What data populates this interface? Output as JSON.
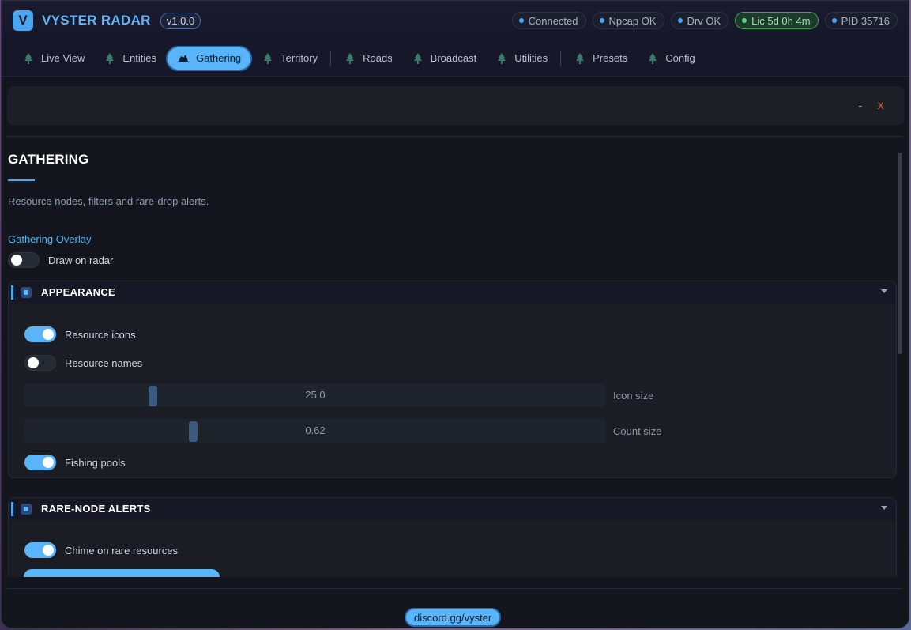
{
  "app": {
    "logo_letter": "V",
    "title": "VYSTER RADAR",
    "version": "v1.0.0"
  },
  "status": [
    {
      "label": "Connected",
      "state": "info"
    },
    {
      "label": "Npcap OK",
      "state": "info"
    },
    {
      "label": "Drv OK",
      "state": "info"
    },
    {
      "label": "Lic 5d 0h 4m",
      "state": "ok"
    },
    {
      "label": "PID 35716",
      "state": "info"
    }
  ],
  "tabs": [
    {
      "label": "Live View",
      "icon": "tree-icon"
    },
    {
      "label": "Entities",
      "icon": "tree-icon"
    },
    {
      "label": "Gathering",
      "icon": "ore-icon",
      "active": true
    },
    {
      "label": "Territory",
      "icon": "tree-icon"
    },
    {
      "label": "Roads",
      "icon": "tree-icon"
    },
    {
      "label": "Broadcast",
      "icon": "tree-icon"
    },
    {
      "label": "Utilities",
      "icon": "tree-icon"
    },
    {
      "label": "Presets",
      "icon": "tree-icon"
    },
    {
      "label": "Config",
      "icon": "tree-icon"
    }
  ],
  "window_controls": {
    "minimize": "-",
    "close": "X"
  },
  "page": {
    "heading": "GATHERING",
    "subtitle": "Resource nodes, filters and rare-drop alerts.",
    "section_label": "Gathering Overlay",
    "draw_on_radar": {
      "label": "Draw on radar",
      "on": false
    }
  },
  "appearance": {
    "title": "APPEARANCE",
    "resource_icons": {
      "label": "Resource icons",
      "on": true
    },
    "resource_names": {
      "label": "Resource names",
      "on": false
    },
    "icon_size": {
      "label": "Icon size",
      "value": "25.0"
    },
    "count_size": {
      "label": "Count size",
      "value": "0.62"
    },
    "fishing_pools": {
      "label": "Fishing pools",
      "on": true
    }
  },
  "rare_alerts": {
    "title": "RARE-NODE ALERTS",
    "chime": {
      "label": "Chime on rare resources",
      "on": true
    }
  },
  "footer": {
    "discord": "discord.gg/vyster"
  },
  "colors": {
    "accent": "#5ab4f8",
    "ok": "#4ae07a",
    "close": "#e05a3a"
  }
}
